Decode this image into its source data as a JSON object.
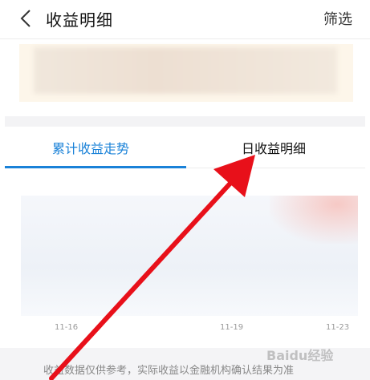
{
  "header": {
    "title": "收益明细",
    "filter_label": "筛选",
    "back_icon": "chevron-left-icon"
  },
  "summary": {
    "content": "blurred"
  },
  "tabs": [
    {
      "label": "累计收益走势",
      "active": true
    },
    {
      "label": "日收益明细",
      "active": false
    }
  ],
  "chart": {
    "x_labels": [
      "11-16",
      "11-19",
      "11-23"
    ]
  },
  "footer": {
    "disclaimer": "收益数据仅供参考，实际收益以金融机构确认结果为准",
    "watermark": "Baidu经验"
  },
  "colors": {
    "accent": "#1a82d8",
    "annotation_arrow": "#e8101a",
    "summary_bg": "#fdf6ea"
  }
}
